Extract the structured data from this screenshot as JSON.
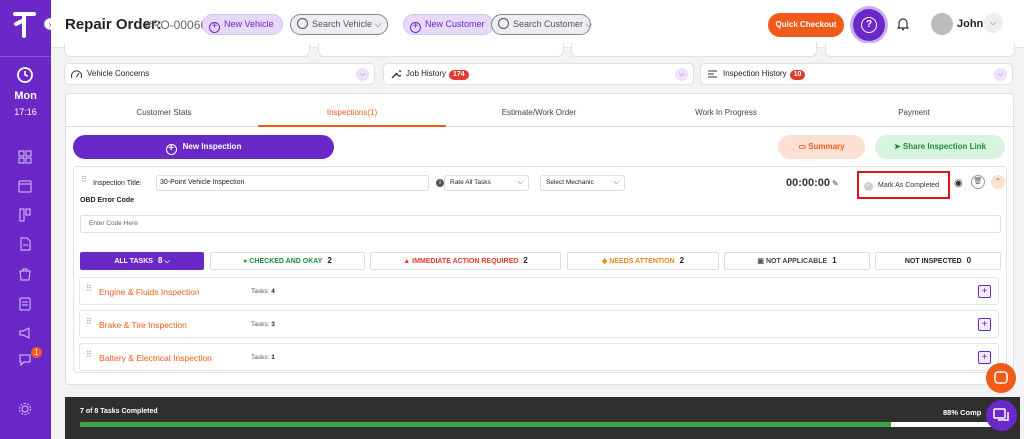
{
  "header": {
    "title": "Repair Order:",
    "ro_number": "#RO-000668",
    "new_vehicle": "New Vehicle",
    "search_vehicle": "Search Vehicle",
    "new_customer": "New Customer",
    "search_customer": "Search Customer",
    "quick_checkout": "Quick Checkout",
    "user_name": "John"
  },
  "sidebar": {
    "day": "Mon",
    "time": "17:16",
    "chat_badge": "1"
  },
  "accordions": {
    "vehicle_concerns": "Vehicle Concerns",
    "job_history": "Job History",
    "job_history_count": "174",
    "inspection_history": "Inspection History",
    "inspection_history_count": "10"
  },
  "tabs": [
    "Customer Stats",
    "Inspections(1)",
    "Estimate/Work Order",
    "Work In Progress",
    "Payment"
  ],
  "actions": {
    "new_inspection": "New Inspection",
    "summary": "Summary",
    "share_link": "Share Inspection Link"
  },
  "inspection": {
    "title_label": "Inspection Title:",
    "title_value": "30-Point Vehicle Inspection",
    "rate_all": "Rate All Tasks",
    "select_mechanic": "Select Mechanic",
    "timer": "00:00:00",
    "mark_completed": "Mark As Completed",
    "obd_label": "OBD Error Code",
    "obd_placeholder": "Enter Code Here"
  },
  "filters": [
    {
      "label": "ALL TASKS",
      "count": "8"
    },
    {
      "label": "CHECKED AND OKAY",
      "count": "2"
    },
    {
      "label": "IMMEDIATE ACTION REQUIRED",
      "count": "2"
    },
    {
      "label": "NEEDS ATTENTION",
      "count": "2"
    },
    {
      "label": "NOT APPLICABLE",
      "count": "1"
    },
    {
      "label": "NOT INSPECTED",
      "count": "0"
    }
  ],
  "categories": [
    {
      "name": "Engine & Fluids Inspection",
      "tasks_label": "Tasks:",
      "tasks": "4"
    },
    {
      "name": "Brake & Tire Inspection",
      "tasks_label": "Tasks:",
      "tasks": "3"
    },
    {
      "name": "Battery & Electrical Inspection",
      "tasks_label": "Tasks:",
      "tasks": "1"
    }
  ],
  "footer": {
    "completed_text": "7 of 8 Tasks Completed",
    "percent_text": "88% Comp",
    "progress_fraction": 0.88
  },
  "colors": {
    "brand_purple": "#6a28c8",
    "accent_orange": "#f25a1a",
    "success_green": "#3ca444",
    "danger_red": "#e13b2f"
  }
}
